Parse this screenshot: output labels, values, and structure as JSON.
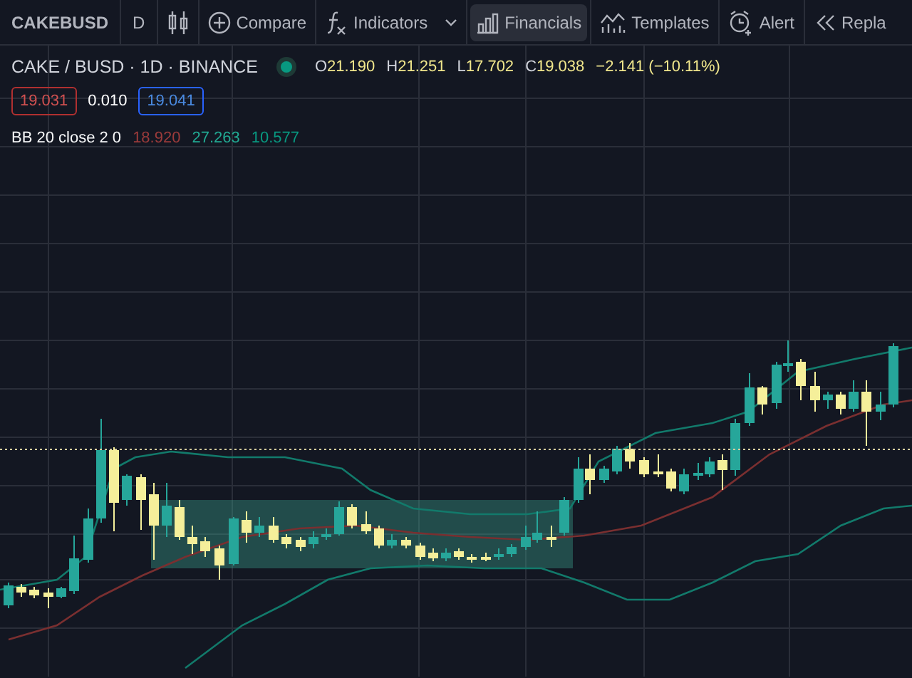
{
  "toolbar": {
    "symbol": "CAKEBUSD",
    "interval": "D",
    "buttons": [
      {
        "kind": "chart-type",
        "selected": false,
        "dropdown": false
      },
      {
        "kind": "compare",
        "label": "Compare",
        "selected": false,
        "dropdown": false
      },
      {
        "kind": "indicators",
        "label": "Indicators",
        "selected": false,
        "dropdown": true
      },
      {
        "kind": "financials",
        "label": "Financials",
        "selected": true,
        "dropdown": false
      },
      {
        "kind": "templates",
        "label": "Templates",
        "selected": false,
        "dropdown": false
      },
      {
        "kind": "alert",
        "label": "Alert",
        "selected": false,
        "dropdown": false
      },
      {
        "kind": "replay",
        "label": "Repla",
        "selected": false,
        "dropdown": false
      }
    ]
  },
  "legend": {
    "title": "CAKE / BUSD · 1D · BINANCE",
    "ohlc": [
      {
        "label": "O",
        "value": "21.190"
      },
      {
        "label": "H",
        "value": "21.251"
      },
      {
        "label": "L",
        "value": "17.702"
      },
      {
        "label": "C",
        "value": "19.038"
      }
    ],
    "change": "−2.141 (−10.11%)",
    "bid": "19.031",
    "spread": "0.010",
    "ask": "19.041",
    "indicator": {
      "name": "BB 20 close 2 0",
      "values": [
        {
          "text": "18.920",
          "color": "#9c3b3b"
        },
        {
          "text": "27.263",
          "color": "#22ab94"
        },
        {
          "text": "10.577",
          "color": "#089981"
        }
      ]
    }
  }
}
